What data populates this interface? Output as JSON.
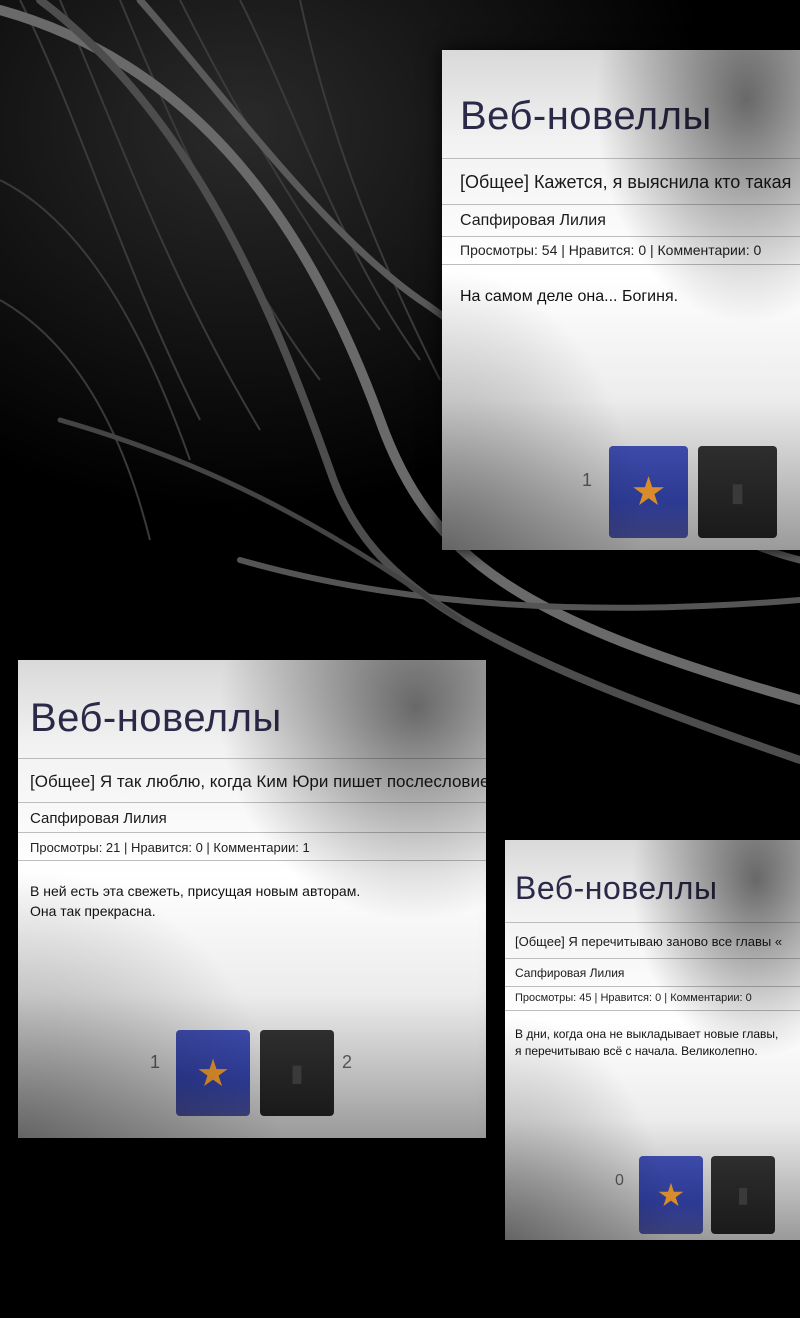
{
  "site_title": "Веб-новеллы",
  "panels": [
    {
      "post_title": "[Общее] Кажется, я выяснила кто такая",
      "author": "Сапфировая Лилия",
      "stats": "Просмотры: 54 | Нравится: 0 | Комментарии: 0",
      "body": "На самом деле она... Богиня.",
      "like_count": "1",
      "dislike_count": ""
    },
    {
      "post_title": "[Общее] Я так люблю, когда Ким Юри пишет послесловия к главе главы",
      "post_title_visible": "[Общее] Я так люблю, когда Ким Юри пишет послесловие главы",
      "author": "Сапфировая Лилия",
      "stats": "Просмотры: 21 | Нравится: 0 | Комментарии: 1",
      "body": "В ней есть эта свежеть, присущая новым авторам.\nОна так прекрасна.",
      "like_count": "1",
      "dislike_count": "2"
    },
    {
      "post_title": "[Общее] Я перечитываю заново все главы «",
      "author": "Сапфировая Лилия",
      "stats": "Просмотры: 45 | Нравится: 0 | Комментарии: 0",
      "body": "В дни, когда она не выкладывает новые главы,\nя перечитываю всё с начала. Великолепно.",
      "like_count": "0",
      "dislike_count": ""
    }
  ],
  "icons": {
    "like": "star-icon",
    "dislike": "dislike-icon"
  },
  "colors": {
    "title": "#2b2948",
    "like_button": "#3d4aa8",
    "star": "#d98c2a",
    "dislike_button": "#1a1a1a"
  }
}
